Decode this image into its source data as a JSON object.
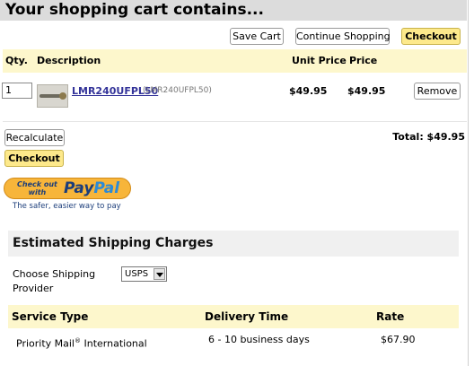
{
  "page": {
    "heading": "Your shopping cart contains..."
  },
  "toolbar": {
    "save_cart": "Save Cart",
    "continue_shopping": "Continue Shopping",
    "checkout": "Checkout"
  },
  "cart": {
    "columns": [
      "Qty.",
      "Description",
      "Unit Price",
      "Price"
    ],
    "items": [
      {
        "qty": "1",
        "thumbnail_icon": "product-thumbnail",
        "name": "LMR240UFPL50",
        "sku": "(LMR240UFPL50)",
        "unit_price": "$49.95",
        "price": "$49.95",
        "remove_label": "Remove"
      }
    ],
    "recalculate_label": "Recalculate",
    "checkout_label": "Checkout",
    "total_text": "Total: $49.95"
  },
  "paypal": {
    "checkout_line1": "Check out",
    "checkout_line2": "with",
    "brand_pay": "Pay",
    "brand_pal": "Pal",
    "tagline": "The safer, easier way to pay"
  },
  "shipping": {
    "heading": "Estimated Shipping Charges",
    "provider_label": "Choose Shipping Provider",
    "provider_value": "USPS",
    "columns": [
      "Service Type",
      "Delivery Time",
      "Rate"
    ],
    "rows": [
      {
        "service": "Priority Mail",
        "service_mark": "®",
        "service_suffix": " International",
        "delivery": "6 - 10 business days",
        "rate": "$67.90"
      }
    ]
  },
  "colors": {
    "accent_yellow": "#fde98b",
    "table_header": "#fdf7cc",
    "link": "#333399"
  }
}
